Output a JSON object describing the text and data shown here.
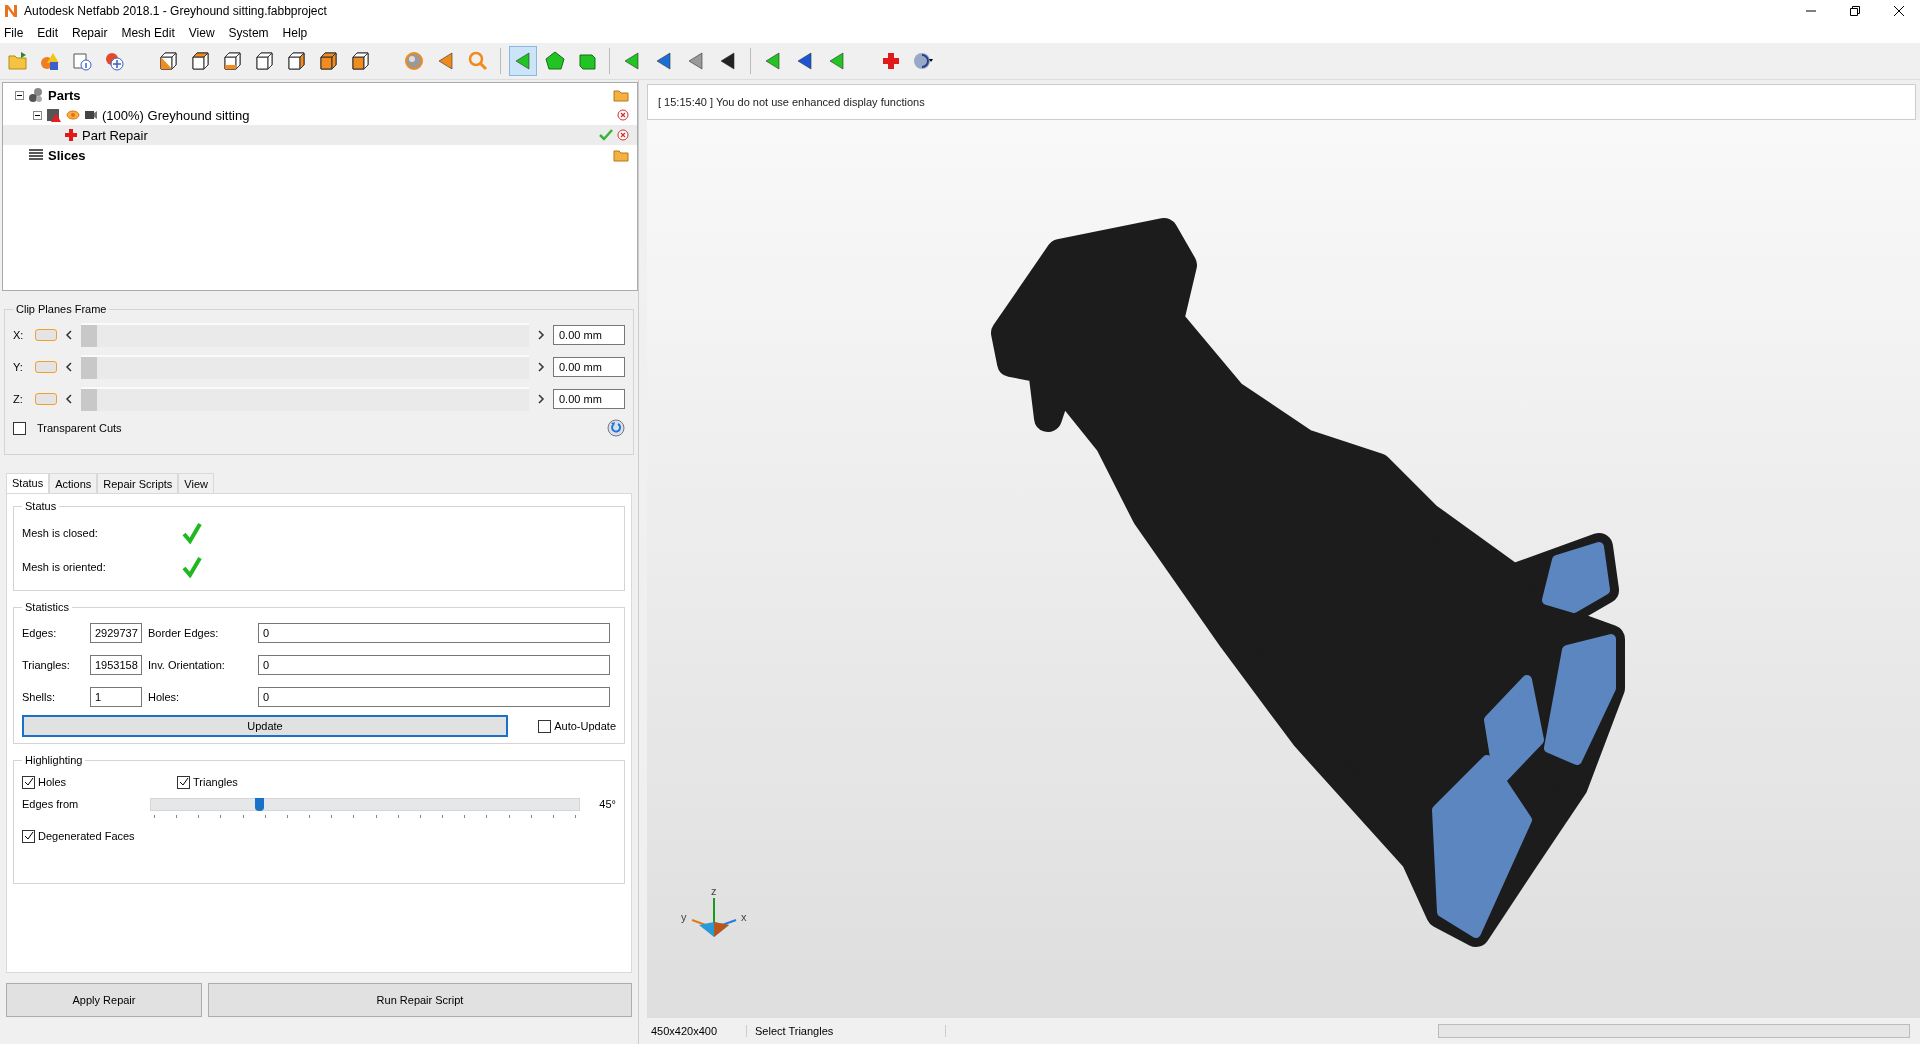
{
  "window": {
    "title": "Autodesk Netfabb 2018.1 - Greyhound sitting.fabbproject"
  },
  "menu": [
    "File",
    "Edit",
    "Repair",
    "Mesh Edit",
    "View",
    "System",
    "Help"
  ],
  "toolbar": [
    {
      "selected": false
    },
    {
      "selected": false
    },
    {
      "selected": false
    },
    {
      "selected": false
    },
    {
      "selected": false
    },
    {
      "selected": false
    },
    {
      "selected": false
    },
    {
      "selected": false
    },
    {
      "selected": false
    },
    {
      "selected": false
    },
    {
      "selected": false
    },
    {
      "selected": false
    },
    {
      "selected": false
    },
    {
      "selected": false
    },
    {
      "selected": true
    },
    {
      "selected": false
    },
    {
      "selected": false
    },
    {
      "selected": false
    },
    {
      "selected": false
    },
    {
      "selected": false
    },
    {
      "selected": false
    },
    {
      "selected": false
    },
    {
      "selected": false
    },
    {
      "selected": false
    },
    {
      "selected": false
    },
    {
      "selected": false
    }
  ],
  "tree": [
    {
      "label": "Parts",
      "kind": "group",
      "expanded": true,
      "selected": false,
      "children": [
        {
          "label": "(100%) Greyhound sitting",
          "kind": "part",
          "expanded": true,
          "selected": false,
          "children": [
            {
              "label": "Part Repair",
              "kind": "repair",
              "selected": true
            }
          ]
        }
      ]
    },
    {
      "label": "Slices",
      "kind": "slices",
      "selected": false
    }
  ],
  "clip_planes": {
    "title": "Clip Planes Frame",
    "axes": [
      {
        "label": "X:",
        "on": false,
        "level": 0,
        "value": "0.00 mm"
      },
      {
        "label": "Y:",
        "on": false,
        "level": 0,
        "value": "0.00 mm"
      },
      {
        "label": "Z:",
        "on": false,
        "level": 0,
        "value": "0.00 mm"
      }
    ],
    "transparent_cuts": {
      "label": "Transparent Cuts",
      "checked": false
    }
  },
  "tabs": [
    {
      "label": "Status",
      "selected": true
    },
    {
      "label": "Actions",
      "selected": false
    },
    {
      "label": "Repair Scripts",
      "selected": false
    },
    {
      "label": "View",
      "selected": false
    }
  ],
  "status": {
    "title": "Status",
    "items": [
      {
        "label": "Mesh is closed:",
        "ok": true
      },
      {
        "label": "Mesh is oriented:",
        "ok": true
      }
    ]
  },
  "statistics": {
    "title": "Statistics",
    "rows": [
      {
        "label": "Edges:",
        "value": "2929737",
        "label2": "Border Edges:",
        "value2": "0"
      },
      {
        "label": "Triangles:",
        "value": "1953158",
        "label2": "Inv. Orientation:",
        "value2": "0"
      },
      {
        "label": "Shells:",
        "value": "1",
        "label2": "Holes:",
        "value2": "0"
      }
    ],
    "update_button": "Update",
    "auto_update": {
      "label": "Auto-Update",
      "checked": false
    }
  },
  "highlighting": {
    "title": "Highlighting",
    "options": [
      {
        "label": "Holes",
        "checked": true
      },
      {
        "label": "Triangles",
        "checked": true
      }
    ],
    "edges": {
      "label": "Edges from",
      "level": 0.25,
      "reading": "45°"
    },
    "degenerated": {
      "label": "Degenerated Faces",
      "checked": true
    }
  },
  "buttons": [
    "Apply Repair",
    "Run Repair Script"
  ],
  "log": "[ 15:15:40 ] You do not use enhanced display functions",
  "viewport": {
    "axes": {
      "x": "x",
      "y": "y",
      "z": "z"
    }
  },
  "status_bar": {
    "dimensions": "450x420x400",
    "mode": "Select Triangles",
    "progress": {
      "level": 0
    }
  }
}
